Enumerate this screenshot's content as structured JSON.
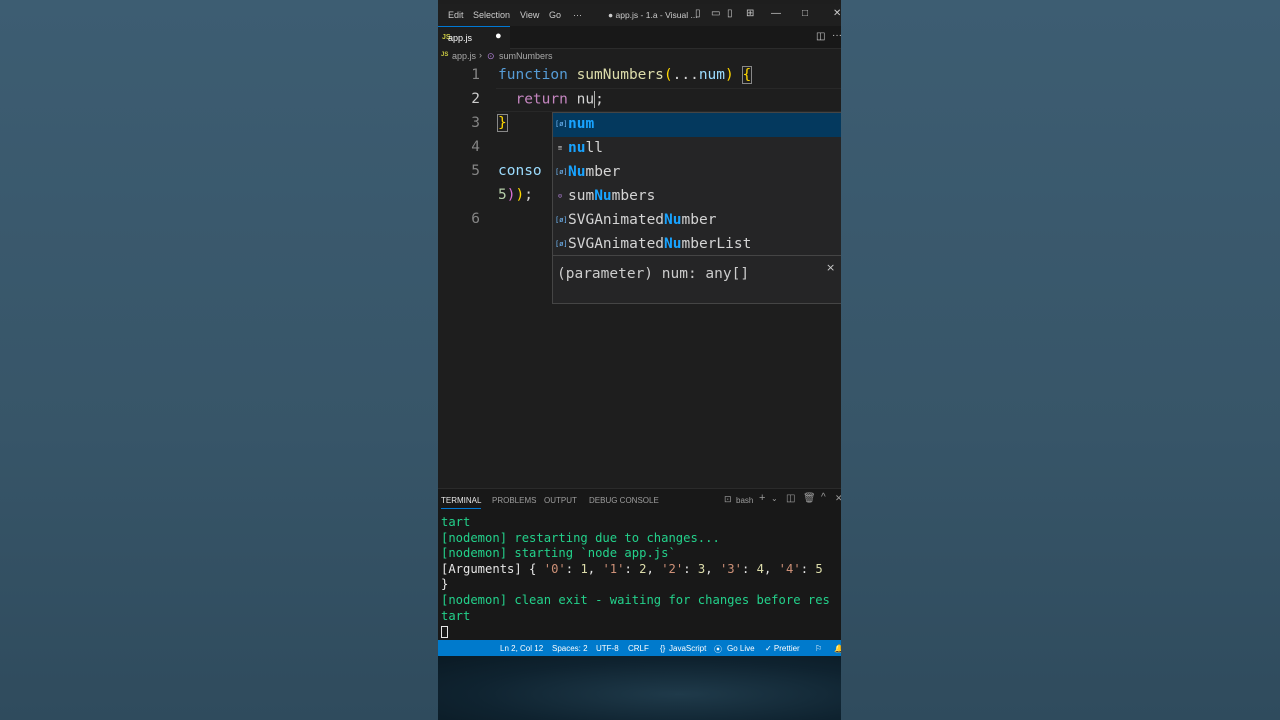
{
  "titlebar": {
    "menus": [
      "Edit",
      "Selection",
      "View",
      "Go",
      "···"
    ],
    "title": "● app.js - 1.a - Visual ..."
  },
  "tabs": [
    {
      "label": "app.js",
      "icon": "JS",
      "modified": true
    }
  ],
  "breadcrumb": {
    "file": "app.js",
    "separator": "›",
    "symbol": "sumNumbers"
  },
  "editor": {
    "current_line": 2,
    "line_numbers": [
      "1",
      "2",
      "3",
      "4",
      "5",
      "6"
    ]
  },
  "suggestions": [
    {
      "kind": "variable",
      "icon": "[ø]",
      "match": "num",
      "rest": ""
    },
    {
      "kind": "keyword",
      "icon": "≡",
      "match": "nu",
      "rest": "ll"
    },
    {
      "kind": "variable",
      "icon": "[ø]",
      "match": "Nu",
      "rest": "mber"
    },
    {
      "kind": "method",
      "icon": "⊙",
      "pre": "sum",
      "match": "Nu",
      "rest": "mbers"
    },
    {
      "kind": "variable",
      "icon": "[ø]",
      "pre": "SVGAnimated",
      "match": "Nu",
      "rest": "mber"
    },
    {
      "kind": "variable",
      "icon": "[ø]",
      "pre": "SVGAnimated",
      "match": "Nu",
      "rest": "mberList"
    }
  ],
  "suggestion_detail": "(parameter) num: any[]",
  "panel": {
    "tabs": [
      "TERMINAL",
      "PROBLEMS",
      "OUTPUT",
      "DEBUG CONSOLE"
    ],
    "shell": "bash"
  },
  "terminal": {
    "lines": [
      "tart",
      "[nodemon] restarting due to changes...",
      "[nodemon] starting `node app.js`",
      "}",
      "[nodemon] clean exit - waiting for changes before res",
      "tart"
    ],
    "args_prefix": "[Arguments] { ",
    "args": [
      [
        "'0'",
        "1"
      ],
      [
        "'1'",
        "2"
      ],
      [
        "'2'",
        "3"
      ],
      [
        "'3'",
        "4"
      ],
      [
        "'4'",
        "5"
      ]
    ]
  },
  "statusbar": {
    "position": "Ln 2, Col 12",
    "spaces": "Spaces: 2",
    "encoding": "UTF-8",
    "eol": "CRLF",
    "language": "JavaScript",
    "golive": "Go Live",
    "prettier": "✓ Prettier"
  },
  "colors": {
    "accent": "#007acc",
    "suggest_highlight": "#18a3ff",
    "terminal_green": "#23d18b"
  }
}
